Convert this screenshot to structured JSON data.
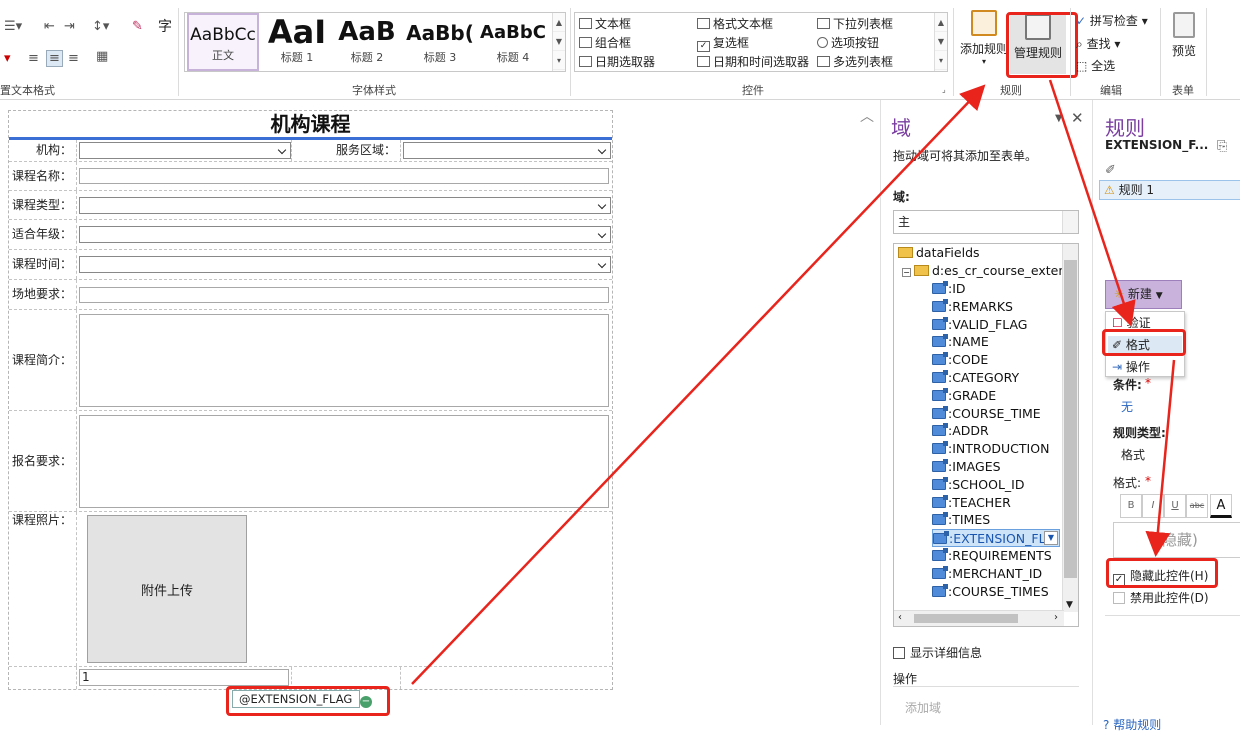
{
  "ribbon": {
    "groups": {
      "text_format": "置文本格式",
      "font_styles": "字体样式",
      "controls": "控件",
      "rules": "规则",
      "edit": "编辑",
      "form": "表单"
    },
    "char_glyph": "字",
    "styles": [
      {
        "sample": "AaBbCc",
        "name": "正文"
      },
      {
        "sample": "AaI",
        "name": "标题 1"
      },
      {
        "sample": "AaB",
        "name": "标题 2"
      },
      {
        "sample": "AaBb(",
        "name": "标题 3"
      },
      {
        "sample": "AaBbC",
        "name": "标题 4"
      }
    ],
    "controls": {
      "textbox": "文本框",
      "rich_textbox": "格式文本框",
      "dropdown": "下拉列表框",
      "combobox": "组合框",
      "checkbox": "复选框",
      "option_button": "选项按钮",
      "date_picker": "日期选取器",
      "datetime_picker": "日期和时间选取器",
      "multi_select": "多选列表框"
    },
    "add_rule": "添加规则",
    "manage_rules": "管理规则",
    "spell_check": "拼写检查",
    "find": "查找",
    "select_all": "全选",
    "preview": "预览"
  },
  "form": {
    "title": "机构课程",
    "org_label": "机构：",
    "service_area_label": "服务区域：",
    "course_name_label": "课程名称：",
    "course_type_label": "课程类型：",
    "grade_label": "适合年级：",
    "course_time_label": "课程时间：",
    "venue_label": "场地要求：",
    "intro_label": "课程简介：",
    "signup_label": "报名要求：",
    "photo_label": "课程照片：",
    "upload_label": "附件上传",
    "bottom_value": "1",
    "extension_flag_tag": "@EXTENSION_FLAG"
  },
  "domain_pane": {
    "title": "域",
    "hint": "拖动域可将其添加至表单。",
    "field_label": "域:",
    "field_value": "主",
    "tree": {
      "root": "dataFields",
      "group": "d:es_cr_course_exten",
      "fields": [
        ":ID",
        ":REMARKS",
        ":VALID_FLAG",
        ":NAME",
        ":CODE",
        ":CATEGORY",
        ":GRADE",
        ":COURSE_TIME",
        ":ADDR",
        ":INTRODUCTION",
        ":IMAGES",
        ":SCHOOL_ID",
        ":TEACHER",
        ":TIMES",
        ":EXTENSION_FL",
        ":REQUIREMENTS",
        ":MERCHANT_ID",
        ":COURSE_TIMES"
      ],
      "selected": ":EXTENSION_FL"
    },
    "show_details": "显示详细信息",
    "actions_label": "操作",
    "add_field": "添加域"
  },
  "rules_pane": {
    "title": "规则",
    "control_name": "EXTENSION_F...",
    "rule_item": "规则 1",
    "new_button": "新建",
    "menu": [
      "验证",
      "格式",
      "操作"
    ],
    "condition_label": "条件:",
    "condition_value": "无",
    "rule_type_label": "规则类型:",
    "rule_type_value": "格式",
    "format_label": "格式:",
    "format_buttons": [
      "B",
      "I",
      "U",
      "abc",
      "A"
    ],
    "preview_text": "(隐藏)",
    "hide_control": "隐藏此控件(H)",
    "hide_checked": true,
    "disable_control": "禁用此控件(D)",
    "help": "帮助规则"
  },
  "colors": {
    "accent": "#7a3fa0",
    "highlight_box": "#e8241c",
    "selection": "#cde3f7",
    "header_rule": "#3b6fd6"
  }
}
